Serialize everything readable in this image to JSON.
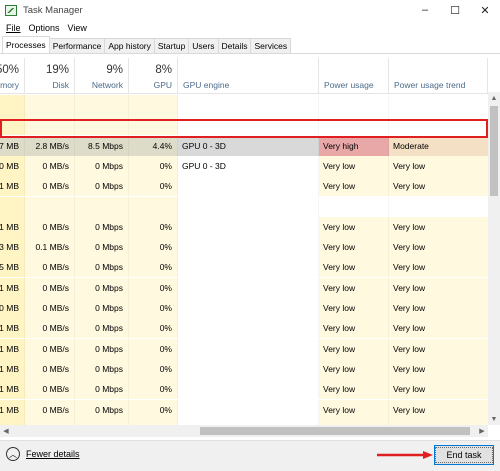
{
  "window": {
    "title": "Task Manager",
    "minimize": "–",
    "maximize": "☐",
    "close": "✕"
  },
  "menu": [
    "File",
    "Options",
    "View"
  ],
  "tabs": [
    {
      "label": "Processes",
      "active": true
    },
    {
      "label": "Performance",
      "active": false
    },
    {
      "label": "App history",
      "active": false
    },
    {
      "label": "Startup",
      "active": false
    },
    {
      "label": "Users",
      "active": false
    },
    {
      "label": "Details",
      "active": false
    },
    {
      "label": "Services",
      "active": false
    }
  ],
  "columns": [
    {
      "key": "memory",
      "pct": "50%",
      "label": "mory"
    },
    {
      "key": "disk",
      "pct": "19%",
      "label": "Disk"
    },
    {
      "key": "network",
      "pct": "9%",
      "label": "Network"
    },
    {
      "key": "gpu",
      "pct": "8%",
      "label": "GPU"
    },
    {
      "key": "gpu_engine",
      "pct": "",
      "label": "GPU engine"
    },
    {
      "key": "power",
      "pct": "",
      "label": "Power usage"
    },
    {
      "key": "power_trend",
      "pct": "",
      "label": "Power usage trend"
    }
  ],
  "rows": [
    {
      "memory": "",
      "disk": "",
      "network": "",
      "gpu": "",
      "gpu_engine": "",
      "power": "",
      "power_trend": ""
    },
    {
      "memory": "",
      "disk": "",
      "network": "",
      "gpu": "",
      "gpu_engine": "",
      "power": "",
      "power_trend": ""
    },
    {
      "memory": "7 MB",
      "disk": "2.8 MB/s",
      "network": "8.5 Mbps",
      "gpu": "4.4%",
      "gpu_engine": "GPU 0 - 3D",
      "power": "Very high",
      "power_trend": "Moderate",
      "highlighted": true
    },
    {
      "memory": "0 MB",
      "disk": "0 MB/s",
      "network": "0 Mbps",
      "gpu": "0%",
      "gpu_engine": "GPU 0 - 3D",
      "power": "Very low",
      "power_trend": "Very low"
    },
    {
      "memory": "1 MB",
      "disk": "0 MB/s",
      "network": "0 Mbps",
      "gpu": "0%",
      "gpu_engine": "",
      "power": "Very low",
      "power_trend": "Very low"
    },
    {
      "memory": "",
      "disk": "",
      "network": "",
      "gpu": "",
      "gpu_engine": "",
      "power": "",
      "power_trend": ""
    },
    {
      "memory": "1 MB",
      "disk": "0 MB/s",
      "network": "0 Mbps",
      "gpu": "0%",
      "gpu_engine": "",
      "power": "Very low",
      "power_trend": "Very low"
    },
    {
      "memory": "3 MB",
      "disk": "0.1 MB/s",
      "network": "0 Mbps",
      "gpu": "0%",
      "gpu_engine": "",
      "power": "Very low",
      "power_trend": "Very low"
    },
    {
      "memory": "5 MB",
      "disk": "0 MB/s",
      "network": "0 Mbps",
      "gpu": "0%",
      "gpu_engine": "",
      "power": "Very low",
      "power_trend": "Very low"
    },
    {
      "memory": "1 MB",
      "disk": "0 MB/s",
      "network": "0 Mbps",
      "gpu": "0%",
      "gpu_engine": "",
      "power": "Very low",
      "power_trend": "Very low"
    },
    {
      "memory": "0 MB",
      "disk": "0 MB/s",
      "network": "0 Mbps",
      "gpu": "0%",
      "gpu_engine": "",
      "power": "Very low",
      "power_trend": "Very low"
    },
    {
      "memory": "1 MB",
      "disk": "0 MB/s",
      "network": "0 Mbps",
      "gpu": "0%",
      "gpu_engine": "",
      "power": "Very low",
      "power_trend": "Very low"
    },
    {
      "memory": "1 MB",
      "disk": "0 MB/s",
      "network": "0 Mbps",
      "gpu": "0%",
      "gpu_engine": "",
      "power": "Very low",
      "power_trend": "Very low"
    },
    {
      "memory": "1 MB",
      "disk": "0 MB/s",
      "network": "0 Mbps",
      "gpu": "0%",
      "gpu_engine": "",
      "power": "Very low",
      "power_trend": "Very low"
    },
    {
      "memory": "1 MB",
      "disk": "0 MB/s",
      "network": "0 Mbps",
      "gpu": "0%",
      "gpu_engine": "",
      "power": "Very low",
      "power_trend": "Very low"
    },
    {
      "memory": "1 MB",
      "disk": "0 MB/s",
      "network": "0 Mbps",
      "gpu": "0%",
      "gpu_engine": "",
      "power": "Very low",
      "power_trend": "Very low"
    },
    {
      "memory": "1 MB",
      "disk": "0 MB/s",
      "network": "0 Mbps",
      "gpu": "0%",
      "gpu_engine": "",
      "power": "Very low",
      "power_trend": "Very low"
    }
  ],
  "colors": {
    "mem_cell": "#fff4c4",
    "cell": "#fff9e0",
    "highlight_row": "#d9d9d9",
    "power_veryhigh": "#e8a8a8",
    "power_moderate": "#f4e0c4",
    "highlight_border": "#e02020"
  },
  "footer": {
    "fewer_details": "Fewer details",
    "end_task": "End task"
  }
}
